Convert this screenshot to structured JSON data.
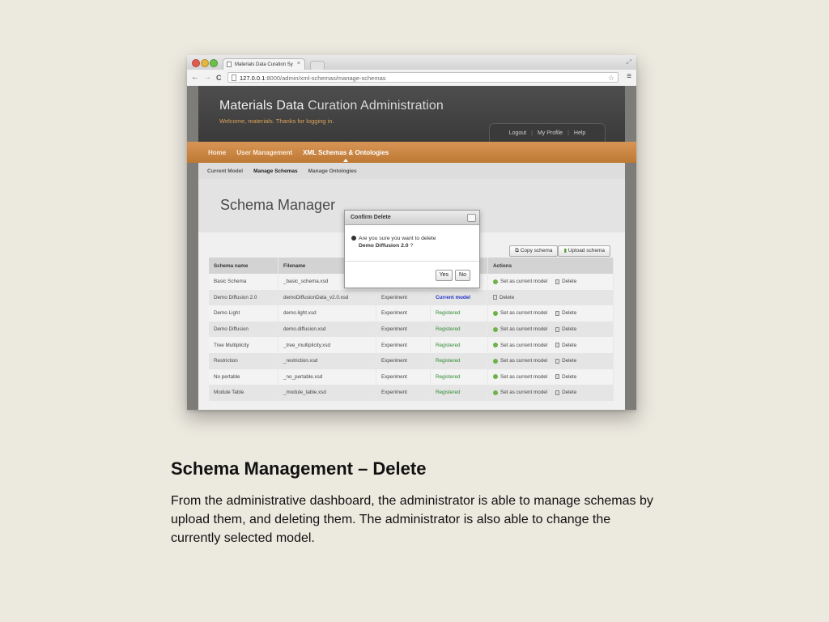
{
  "browser": {
    "tab_title": "Materials Data Curation Sy",
    "tab_close": "×",
    "url_host": "127.0.0.1",
    "url_rest": ":8000/admin/xml-schemas/manage-schemas",
    "back": "←",
    "forward": "→",
    "reload": "C",
    "star": "☆",
    "menu": "≡",
    "resize": "⤢"
  },
  "app": {
    "title_bold": "Materials Data",
    "title_light": " Curation Administration",
    "welcome": "Welcome, materials. Thanks for logging in.",
    "toplinks": [
      "Logout",
      "My Profile",
      "Help"
    ],
    "toplink_sep": "|",
    "nav": [
      "Home",
      "User Management",
      "XML Schemas & Ontologies"
    ],
    "subnav": [
      "Current Model",
      "Manage Schemas",
      "Manage Ontologies"
    ],
    "manager_title": "Schema Manager",
    "copy_schema": "Copy schema",
    "upload_schema": "Upload schema"
  },
  "table": {
    "headers": [
      "Schema name",
      "Filename",
      "",
      "",
      "Actions"
    ],
    "rows": [
      {
        "name": "Basic Schema",
        "file": "_basic_schema.xsd",
        "type": "",
        "status": "",
        "set": "Set as current model",
        "delete": "Delete"
      },
      {
        "name": "Demo Diffusion 2.0",
        "file": "demoDiffusionData_v2.0.xsd",
        "type": "Experiment",
        "status": "Current model",
        "set": "",
        "delete": "Delete"
      },
      {
        "name": "Demo Light",
        "file": "demo.light.xsd",
        "type": "Experiment",
        "status": "Registered",
        "set": "Set as current model",
        "delete": "Delete"
      },
      {
        "name": "Demo Diffusion",
        "file": "demo.diffusion.xsd",
        "type": "Experiment",
        "status": "Registered",
        "set": "Set as current model",
        "delete": "Delete"
      },
      {
        "name": "Tree Multiplicity",
        "file": "_tree_multiplicity.xsd",
        "type": "Experiment",
        "status": "Registered",
        "set": "Set as current model",
        "delete": "Delete"
      },
      {
        "name": "Restriction",
        "file": "_restriction.xsd",
        "type": "Experiment",
        "status": "Registered",
        "set": "Set as current model",
        "delete": "Delete"
      },
      {
        "name": "No pertable",
        "file": "_no_pertable.xsd",
        "type": "Experiment",
        "status": "Registered",
        "set": "Set as current model",
        "delete": "Delete"
      },
      {
        "name": "Module Table",
        "file": "_module_table.xsd",
        "type": "Experiment",
        "status": "Registered",
        "set": "Set as current model",
        "delete": "Delete"
      }
    ]
  },
  "dialog": {
    "title": "Confirm Delete",
    "question": "Are you sure you want to delete",
    "target": "Demo Diffusion 2.0",
    "qmark": " ?",
    "yes": "Yes",
    "no": "No"
  },
  "slide": {
    "title": "Schema Management – Delete",
    "body": "From the administrative dashboard, the administrator is able to manage schemas by upload them, and deleting them.  The administrator is also able to change the currently selected model."
  }
}
